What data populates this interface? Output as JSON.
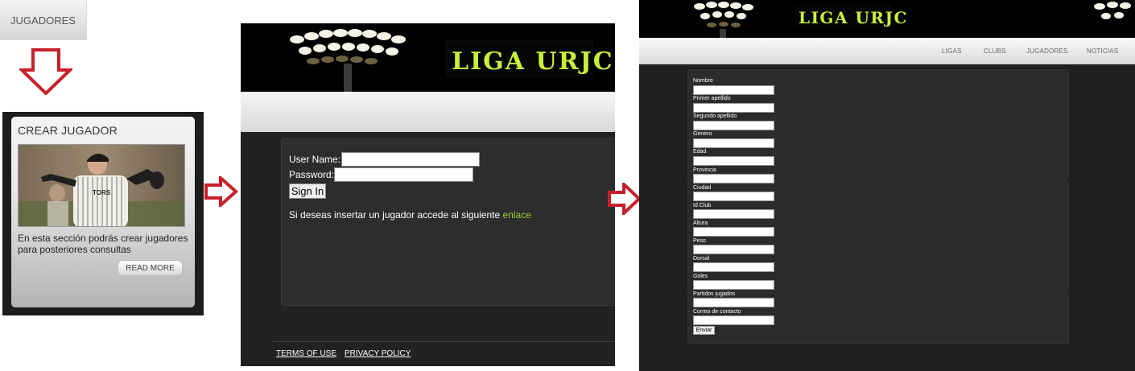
{
  "panel1": {
    "nav_tab": "JUGADORES",
    "card_title": "CREAR JUGADOR",
    "card_description": "En esta sección podrás crear jugadores para posteriores consultas",
    "read_more": "READ MORE"
  },
  "panel2": {
    "logo_text": "LIGA URJC",
    "username_label": "User Name:",
    "password_label": "Password:",
    "signin_label": "Sign In",
    "info_text": "Si deseas insertar un jugador accede al siguiente",
    "link_text": "enlace",
    "terms": "TERMS OF USE",
    "privacy": "PRIVACY POLICY"
  },
  "panel3": {
    "logo_text": "LIGA URJC",
    "nav": [
      "LIGAS",
      "CLUBS",
      "JUGADORES",
      "NOTICIAS"
    ],
    "fields": [
      "Nombre",
      "Primer apellido",
      "Segundo apellido",
      "Genero",
      "Edad",
      "Provincia",
      "Ciudad",
      "Id Club",
      "Altura",
      "Peso",
      "Dorsal",
      "Goles",
      "Partidos jugados",
      "Correo de contacto"
    ],
    "submit": "Enviar"
  },
  "colors": {
    "arrow_red": "#c8202a",
    "logo_yellow_green": "#c9f03a",
    "link_green": "#9acd32",
    "dark_bg": "#222222"
  },
  "icons": {
    "down_arrow": "arrow-down-icon",
    "right_arrow": "arrow-right-icon"
  }
}
